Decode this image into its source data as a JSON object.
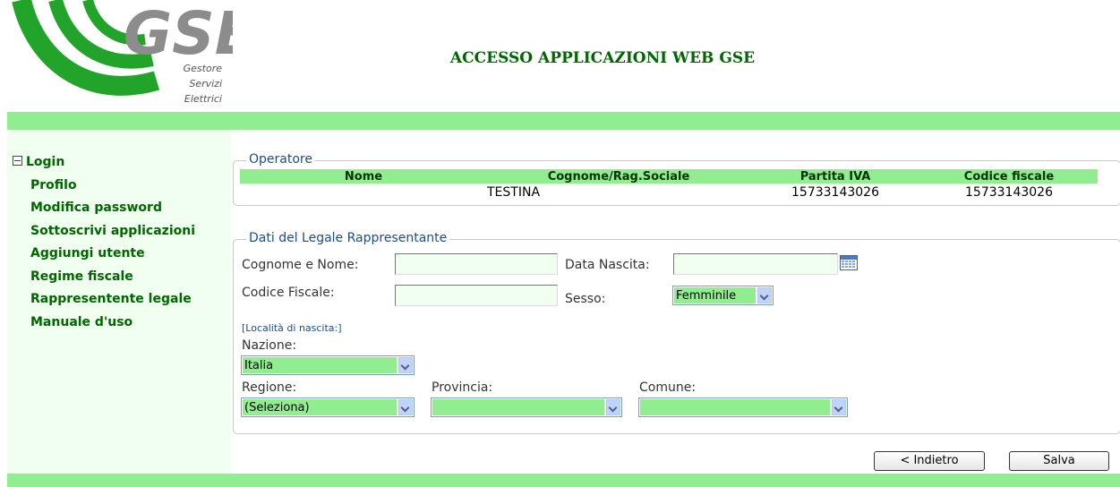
{
  "logo": {
    "name": "GSE",
    "subtitle": [
      "Gestore",
      "Servizi",
      "Elettrici"
    ]
  },
  "header": {
    "title": "ACCESSO APPLICAZIONI WEB GSE"
  },
  "nav": {
    "root": "Login",
    "items": [
      "Profilo",
      "Modifica password",
      "Sottoscrivi applicazioni",
      "Aggiungi utente",
      "Regime fiscale",
      "Rappresentente legale",
      "Manuale d'uso"
    ]
  },
  "operatore": {
    "legend": "Operatore",
    "columns": [
      "Nome",
      "Cognome/Rag.Sociale",
      "Partita IVA",
      "Codice fiscale"
    ],
    "row": [
      "",
      "TESTINA",
      "15733143026",
      "15733143026"
    ]
  },
  "legale": {
    "legend": "Dati del Legale Rappresentante",
    "cognome_nome_label": "Cognome e Nome:",
    "cognome_nome_value": "",
    "data_nascita_label": "Data Nascita:",
    "data_nascita_value": "",
    "codice_fiscale_label": "Codice Fiscale:",
    "codice_fiscale_value": "",
    "sesso_label": "Sesso:",
    "sesso_value": "Femminile",
    "localita_note": "[Località di nascita:]",
    "nazione_label": "Nazione:",
    "nazione_value": "Italia",
    "regione_label": "Regione:",
    "regione_value": "(Seleziona)",
    "provincia_label": "Provincia:",
    "provincia_value": "",
    "comune_label": "Comune:",
    "comune_value": ""
  },
  "buttons": {
    "back": "< Indietro",
    "save": "Salva"
  },
  "colors": {
    "accent_green": "#90ee90",
    "nav_text": "#006600",
    "legend_blue": "#1a4d8c",
    "logo_green": "#22a32a",
    "logo_gray": "#8c8c8c"
  }
}
